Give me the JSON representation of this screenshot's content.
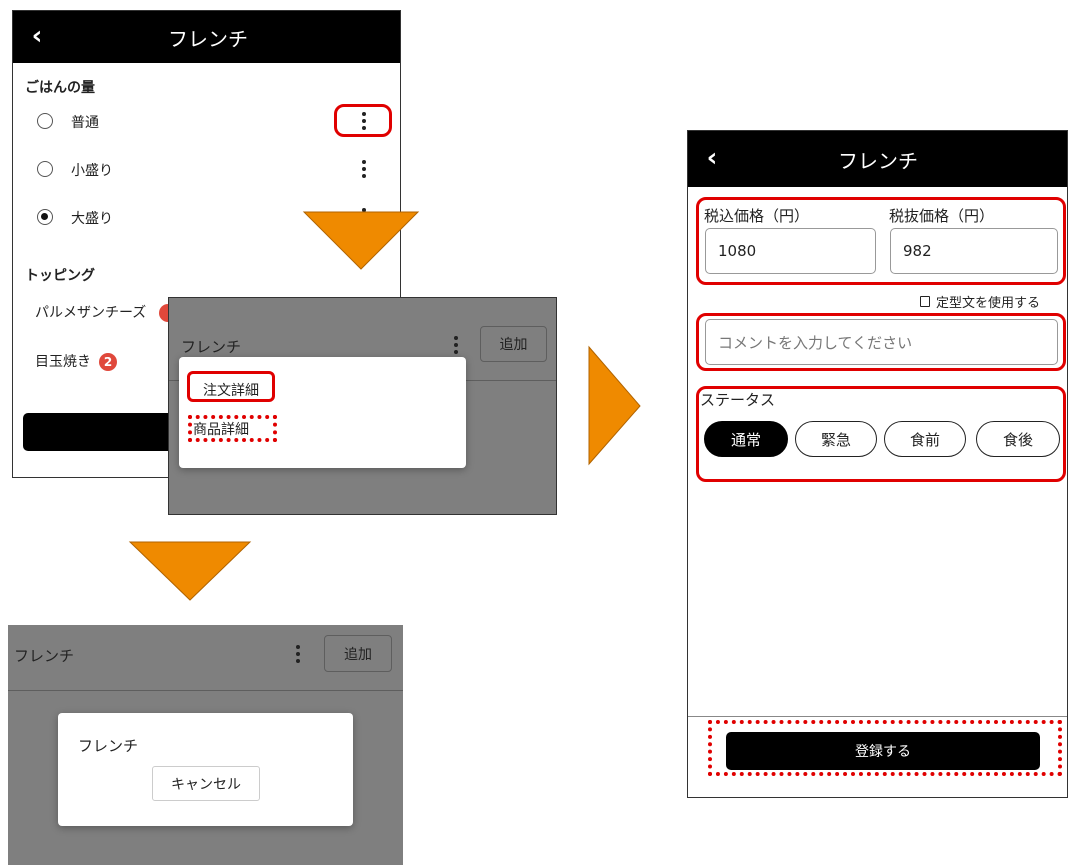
{
  "screen1": {
    "title": "フレンチ",
    "section_rice": "ごはんの量",
    "options": [
      "普通",
      "小盛り",
      "大盛り"
    ],
    "selected_option": "大盛り",
    "section_topping": "トッピング",
    "toppings": [
      {
        "label": "パルメザンチーズ"
      },
      {
        "label": "目玉焼き",
        "count": "2"
      }
    ]
  },
  "screen2": {
    "title": "フレンチ",
    "add_label": "追加",
    "menu_items": [
      "注文詳細",
      "商品詳細"
    ]
  },
  "screen3": {
    "title": "フレンチ",
    "add_label": "追加",
    "dialog_title": "フレンチ",
    "cancel_label": "キャンセル"
  },
  "screen4": {
    "title": "フレンチ",
    "price_tax_in_label": "税込価格（円）",
    "price_tax_in_value": "1080",
    "price_tax_out_label": "税抜価格（円）",
    "price_tax_out_value": "982",
    "template_link": "定型文を使用する",
    "comment_placeholder": "コメントを入力してください",
    "status_label": "ステータス",
    "status_options": [
      "通常",
      "緊急",
      "食前",
      "食後"
    ],
    "selected_status": "通常",
    "submit_label": "登録する"
  },
  "colors": {
    "arrow": "#ef8a00",
    "highlight": "#e00000",
    "badge": "#e0483b",
    "overlay": "#7f7f7f"
  }
}
